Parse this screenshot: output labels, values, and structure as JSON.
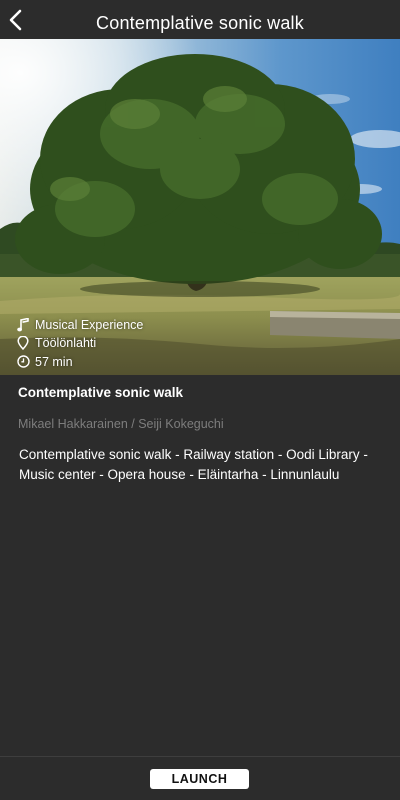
{
  "header": {
    "title": "Contemplative sonic walk",
    "back_icon": "chevron-left-icon"
  },
  "hero": {
    "category": "Musical Experience",
    "category_icon": "music-note-icon",
    "location": "Töölönlahti",
    "location_icon": "map-pin-icon",
    "duration": "57 min",
    "duration_icon": "clock-icon"
  },
  "info": {
    "title": "Contemplative sonic walk",
    "authors": "Mikael Hakkarainen / Seiji Kokeguchi",
    "description": "Contemplative sonic walk - Railway station - Oodi Library - Music center - Opera house - Eläintarha - Linnunlaulu"
  },
  "footer": {
    "launch_label": "LAUNCH"
  },
  "colors": {
    "background": "#2c2c2c",
    "text": "#ffffff",
    "muted_text": "#7d7d7d",
    "button_bg": "#ffffff",
    "button_text": "#111111"
  }
}
